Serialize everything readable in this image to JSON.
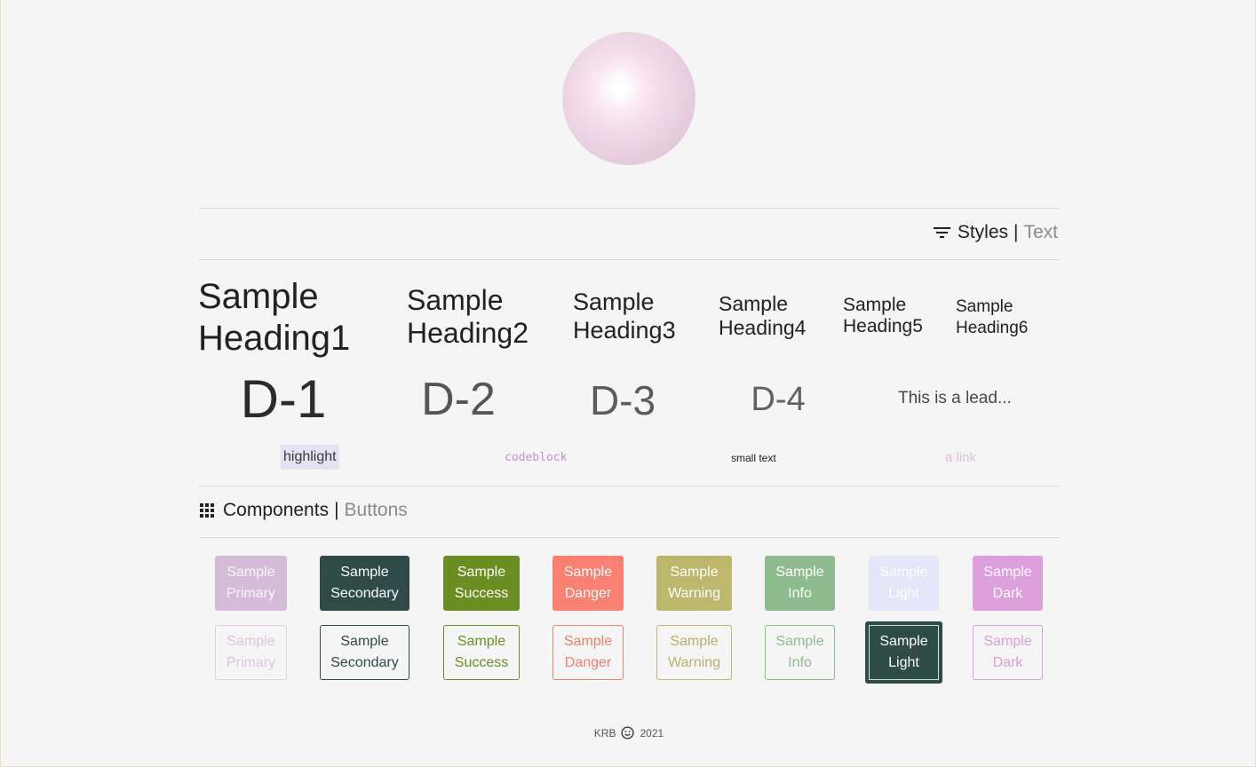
{
  "styles_section": {
    "strong": "Styles",
    "separator": "|",
    "light": "Text",
    "icon": "filter-list-icon"
  },
  "headings": {
    "h1": [
      "Sample",
      "Heading1"
    ],
    "h2": [
      "Sample",
      "Heading2"
    ],
    "h3": [
      "Sample",
      "Heading3"
    ],
    "h4": [
      "Sample",
      "Heading4"
    ],
    "h5": [
      "Sample",
      "Heading5"
    ],
    "h6": [
      "Sample",
      "Heading6"
    ]
  },
  "displays": {
    "d1": "D-1",
    "d2": "D-2",
    "d3": "D-3",
    "d4": "D-4",
    "lead": "This is a lead..."
  },
  "text_samples": {
    "highlight": "highlight",
    "codeblock": "codeblock",
    "small": "small text",
    "link": "a link"
  },
  "components_section": {
    "strong": "Components",
    "separator": "|",
    "light": "Buttons",
    "icon": "apps-grid-icon"
  },
  "buttons_solid": [
    [
      "Sample",
      "Primary"
    ],
    [
      "Sample",
      "Secondary"
    ],
    [
      "Sample",
      "Success"
    ],
    [
      "Sample",
      "Danger"
    ],
    [
      "Sample",
      "Warning"
    ],
    [
      "Sample",
      "Info"
    ],
    [
      "Sample",
      "Light"
    ],
    [
      "Sample",
      "Dark"
    ]
  ],
  "buttons_outline": [
    [
      "Sample",
      "Primary"
    ],
    [
      "Sample",
      "Secondary"
    ],
    [
      "Sample",
      "Success"
    ],
    [
      "Sample",
      "Danger"
    ],
    [
      "Sample",
      "Warning"
    ],
    [
      "Sample",
      "Info"
    ],
    [
      "Sample",
      "Light"
    ],
    [
      "Sample",
      "Dark"
    ]
  ],
  "footer": {
    "author": "KRB",
    "icon": "smile-icon",
    "year": "2021"
  },
  "colors": {
    "background": "#f5f5f5",
    "primary": "#d4bcd8",
    "secondary": "#2e4a49",
    "success": "#6b8e23",
    "danger": "#fa8072",
    "warning": "#bdb76b",
    "info": "#8fbc8f",
    "light": "#e6e6fa",
    "dark": "#dda0dd"
  }
}
